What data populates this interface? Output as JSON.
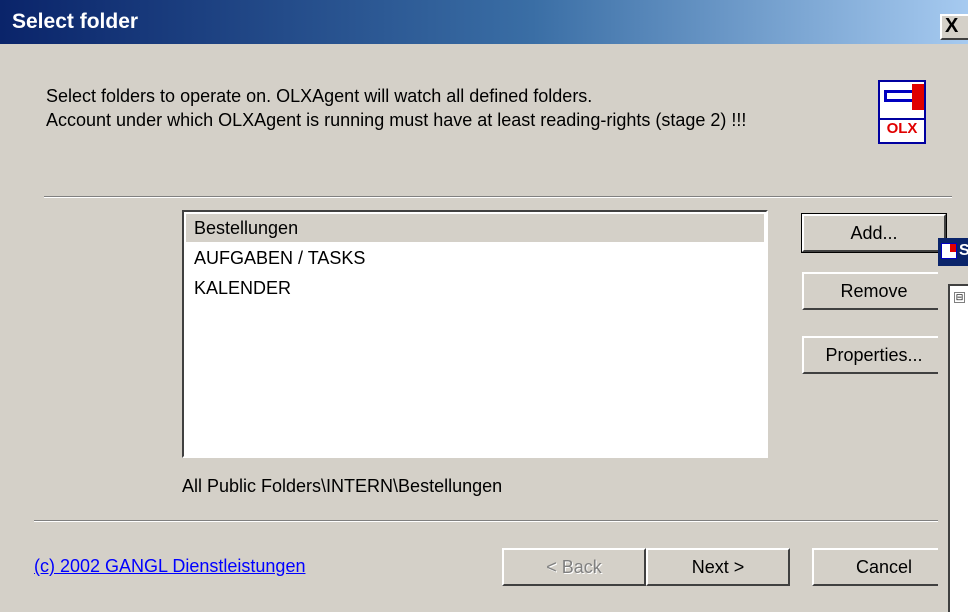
{
  "window": {
    "title": "Select folder",
    "close_glyph": "X"
  },
  "intro": {
    "line1": "Select folders to operate on. OLXAgent will watch all defined folders.",
    "line2": "Account under which OLXAgent is running must have at least reading-rights (stage 2) !!!"
  },
  "logo": {
    "text": "OLX"
  },
  "folders": {
    "items": [
      "Bestellungen",
      "AUFGABEN / TASKS",
      "KALENDER"
    ],
    "selected_index": 0,
    "path": "All Public Folders\\INTERN\\Bestellungen"
  },
  "buttons": {
    "add": "Add...",
    "remove": "Remove",
    "properties": "Properties...",
    "back": "< Back",
    "next": "Next >",
    "cancel": "Cancel"
  },
  "footer": {
    "copyright": "(c) 2002 GANGL Dienstleistungen"
  },
  "side_window": {
    "title_fragment": "S",
    "tree_toggle": "⊟"
  },
  "colors": {
    "titlebar": "#0a246a",
    "face": "#d4d0c8",
    "link": "#0000ff",
    "logo_red": "#e00000"
  }
}
